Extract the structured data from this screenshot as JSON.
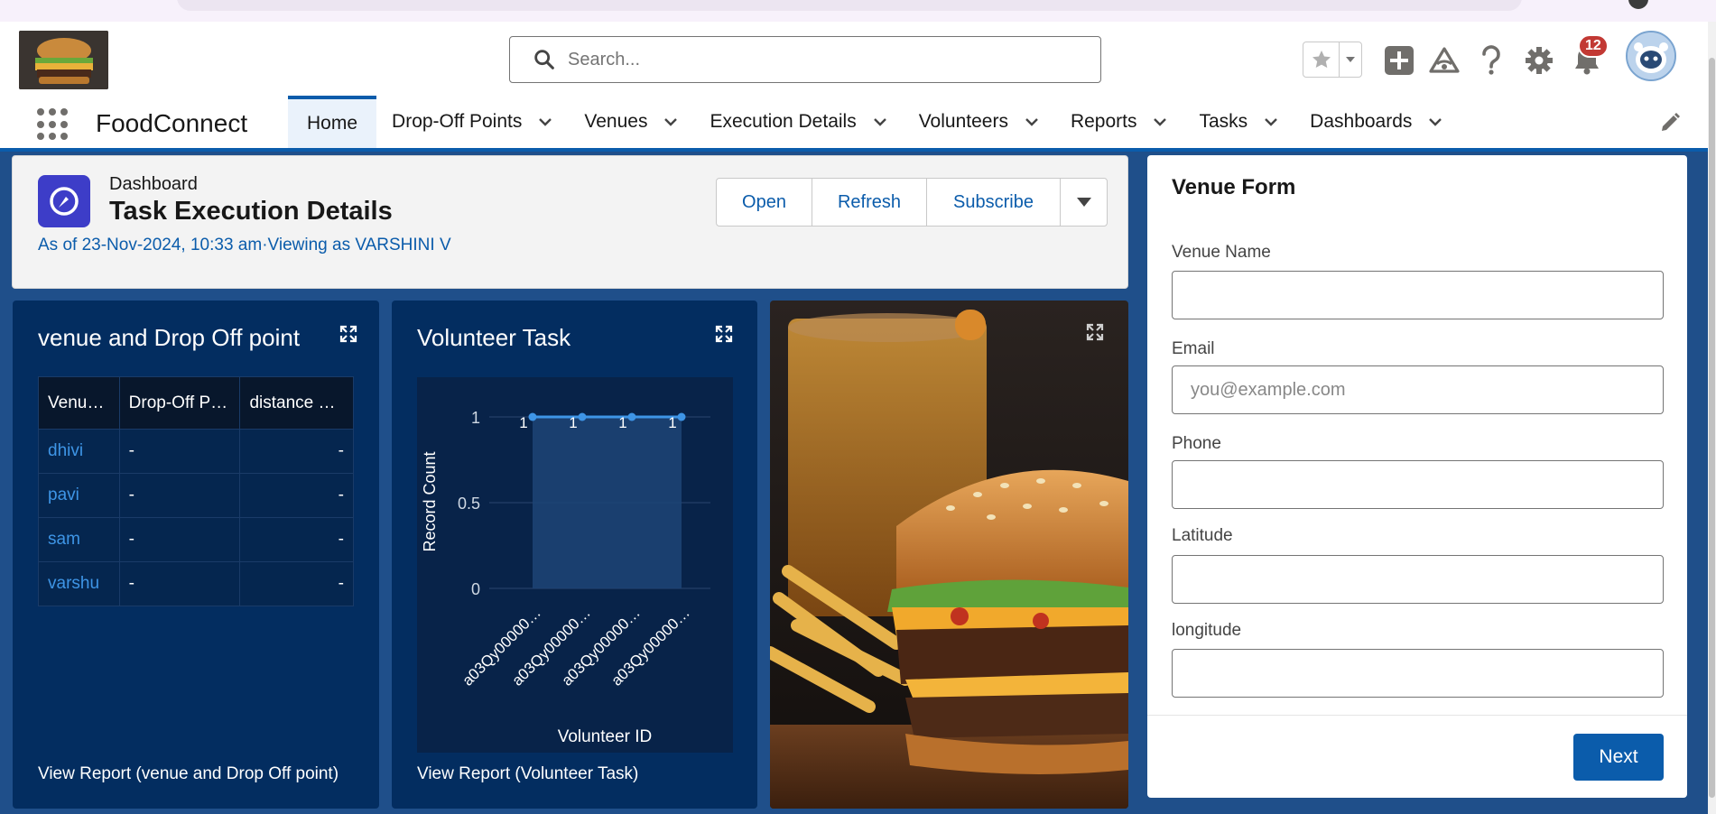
{
  "header": {
    "search_placeholder": "Search...",
    "notification_count": "12"
  },
  "nav": {
    "app_name": "FoodConnect",
    "items": [
      {
        "label": "Home"
      },
      {
        "label": "Drop-Off Points"
      },
      {
        "label": "Venues"
      },
      {
        "label": "Execution Details"
      },
      {
        "label": "Volunteers"
      },
      {
        "label": "Reports"
      },
      {
        "label": "Tasks"
      },
      {
        "label": "Dashboards"
      }
    ]
  },
  "dashboard": {
    "kicker": "Dashboard",
    "title": "Task Execution Details",
    "meta": "As of 23-Nov-2024, 10:33 am·Viewing as VARSHINI V",
    "buttons": {
      "open": "Open",
      "refresh": "Refresh",
      "subscribe": "Subscribe"
    }
  },
  "widget_table": {
    "title": "venue and Drop Off point",
    "columns": [
      "Venu…",
      "Drop-Off P…",
      "distance …"
    ],
    "rows": [
      {
        "venue": "dhivi",
        "drop": "-",
        "distance": "-"
      },
      {
        "venue": "pavi",
        "drop": "-",
        "distance": "-"
      },
      {
        "venue": "sam",
        "drop": "-",
        "distance": "-"
      },
      {
        "venue": "varshu",
        "drop": "-",
        "distance": "-"
      }
    ],
    "link": "View Report (venue and Drop Off point)"
  },
  "widget_chart": {
    "title": "Volunteer Task",
    "link": "View Report (Volunteer Task)"
  },
  "chart_data": {
    "type": "line",
    "title": "Volunteer Task",
    "xlabel": "Volunteer ID",
    "ylabel": "Record Count",
    "categories": [
      "a03Qy00000…",
      "a03Qy00000…",
      "a03Qy00000…",
      "a03Qy00000…"
    ],
    "values": [
      1,
      1,
      1,
      1
    ],
    "data_labels": [
      "1",
      "1",
      "1",
      "1"
    ],
    "yticks": [
      "1",
      "0.5",
      "0"
    ],
    "ylim": [
      0,
      1
    ],
    "colors": {
      "line": "#3e95e6",
      "fill": "#1d4475"
    }
  },
  "form": {
    "title": "Venue Form",
    "fields": [
      {
        "label": "Venue Name",
        "placeholder": ""
      },
      {
        "label": "Email",
        "placeholder": "you@example.com"
      },
      {
        "label": "Phone",
        "placeholder": ""
      },
      {
        "label": "Latitude",
        "placeholder": ""
      },
      {
        "label": "longitude",
        "placeholder": ""
      }
    ],
    "next_label": "Next"
  },
  "colors": {
    "brand": "#0b5cab",
    "widget_bg": "#032d60",
    "badge": "#c23934"
  }
}
